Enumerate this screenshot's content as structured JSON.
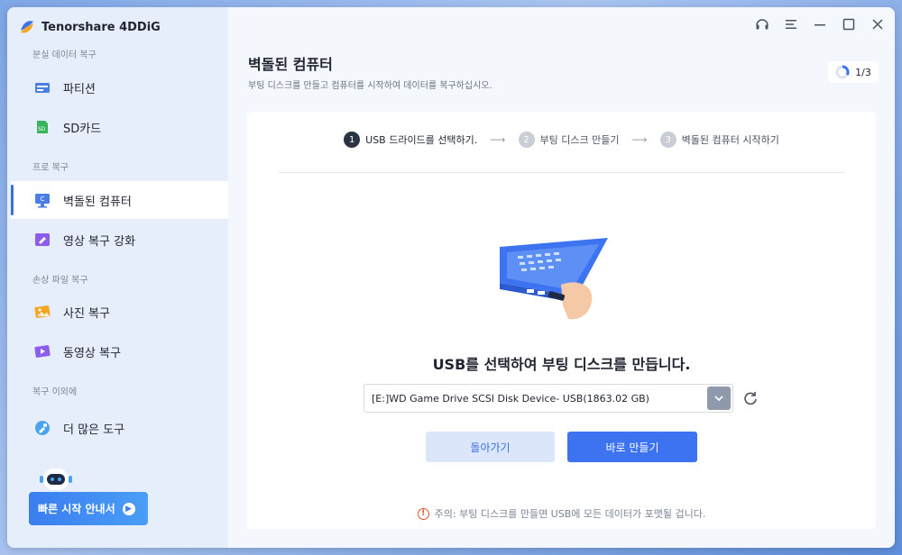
{
  "app": {
    "name": "Tenorshare 4DDiG"
  },
  "sidebar": {
    "sections": [
      {
        "label": "분실 데이터 복구"
      },
      {
        "label": "프로 복구"
      },
      {
        "label": "손상 파일 복구"
      },
      {
        "label": "복구 이외에"
      }
    ],
    "items": [
      {
        "label": "파티션",
        "icon": "partition-icon"
      },
      {
        "label": "SD카드",
        "icon": "sd-card-icon"
      },
      {
        "label": "벽돌된 컴퓨터",
        "icon": "crashed-computer-icon",
        "active": true
      },
      {
        "label": "영상 복구 강화",
        "icon": "video-repair-icon"
      },
      {
        "label": "사진 복구",
        "icon": "photo-icon"
      },
      {
        "label": "동영상 복구",
        "icon": "video-icon"
      },
      {
        "label": "더 많은 도구",
        "icon": "tools-icon"
      }
    ],
    "guide_button": {
      "label": "빠른 시작 안내서"
    }
  },
  "page": {
    "title": "벽돌된 컴퓨터",
    "subtitle": "부팅 디스크를 만들고 컴퓨터를 시작하여 데이터를 복구하십시오.",
    "step_counter": "1/3",
    "step_progress": 0.333
  },
  "steps": [
    {
      "num": "1",
      "label": "USB 드라이드를 선택하기.",
      "active": true
    },
    {
      "num": "2",
      "label": "부팅 디스크 만들기",
      "active": false
    },
    {
      "num": "3",
      "label": "벽돌된 컴퓨터 시작하기",
      "active": false
    }
  ],
  "content": {
    "headline": "USB를 선택하여 부팅 디스크를 만듭니다.",
    "selected_drive": "[E:]WD Game Drive SCSI Disk Device- USB(1863.02 GB)",
    "back_button": "돌아가기",
    "create_button": "바로 만들기",
    "warning": "주의: 부팅 디스크를 만들면 USB에 모든 데이터가 포맷될 겁니다."
  },
  "colors": {
    "accent": "#3d73f0",
    "sidebar_bg": "#e6eefb",
    "warning": "#e0522c"
  }
}
